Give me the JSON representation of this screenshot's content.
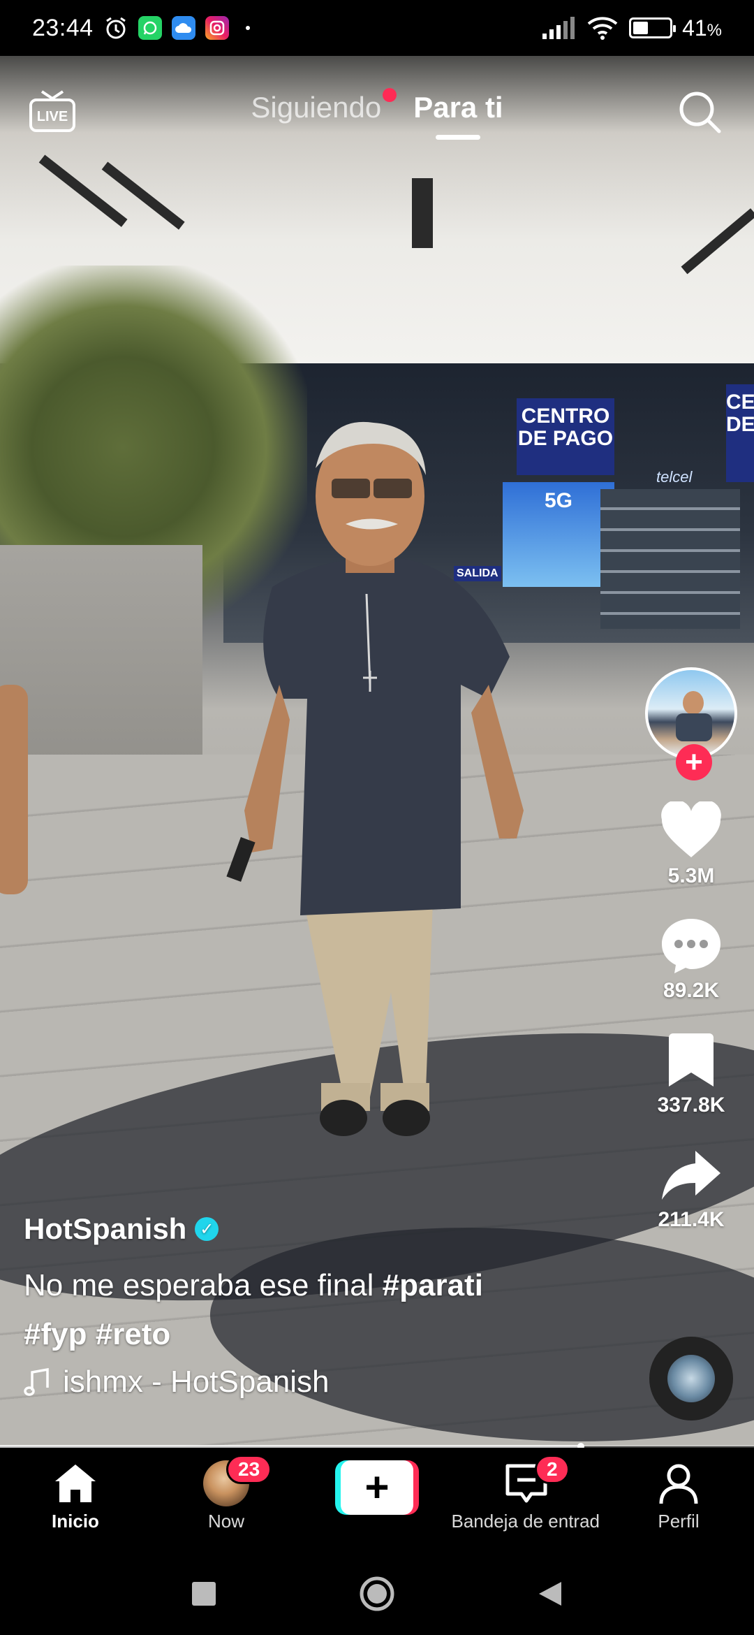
{
  "status_bar": {
    "time": "23:44",
    "battery_percent": "41",
    "battery_symbol": "%",
    "app_icons": [
      "alarm-icon",
      "whatsapp-icon",
      "cloud-icon",
      "instagram-icon"
    ]
  },
  "top_nav": {
    "live_label": "LIVE",
    "tabs": [
      {
        "label": "Siguiendo",
        "active": false,
        "has_dot": true
      },
      {
        "label": "Para ti",
        "active": true
      }
    ]
  },
  "video_scene": {
    "store_sign": "CENTRO DE PAGO",
    "store_sign_partial": "CE DE",
    "promo_label": "5G",
    "operator_sign": "telcel",
    "side_sign": "SALIDA"
  },
  "rail": {
    "likes": "5.3M",
    "comments": "89.2K",
    "saves": "337.8K",
    "shares": "211.4K"
  },
  "caption": {
    "username": "HotSpanish",
    "verified": true,
    "text": "No me esperaba ese final ",
    "tag1": "#parati",
    "tag2": "#fyp",
    "tag3": "#reto",
    "music": "ishmx - HotSpanish"
  },
  "playback": {
    "progress": 0.77
  },
  "bottom_nav": {
    "home": "Inicio",
    "now": "Now",
    "now_badge": "23",
    "inbox": "Bandeja de entrad",
    "inbox_badge": "2",
    "profile": "Perfil"
  },
  "colors": {
    "accent": "#fe2c55",
    "cyan": "#25f4ee",
    "verified": "#20d5ec"
  }
}
